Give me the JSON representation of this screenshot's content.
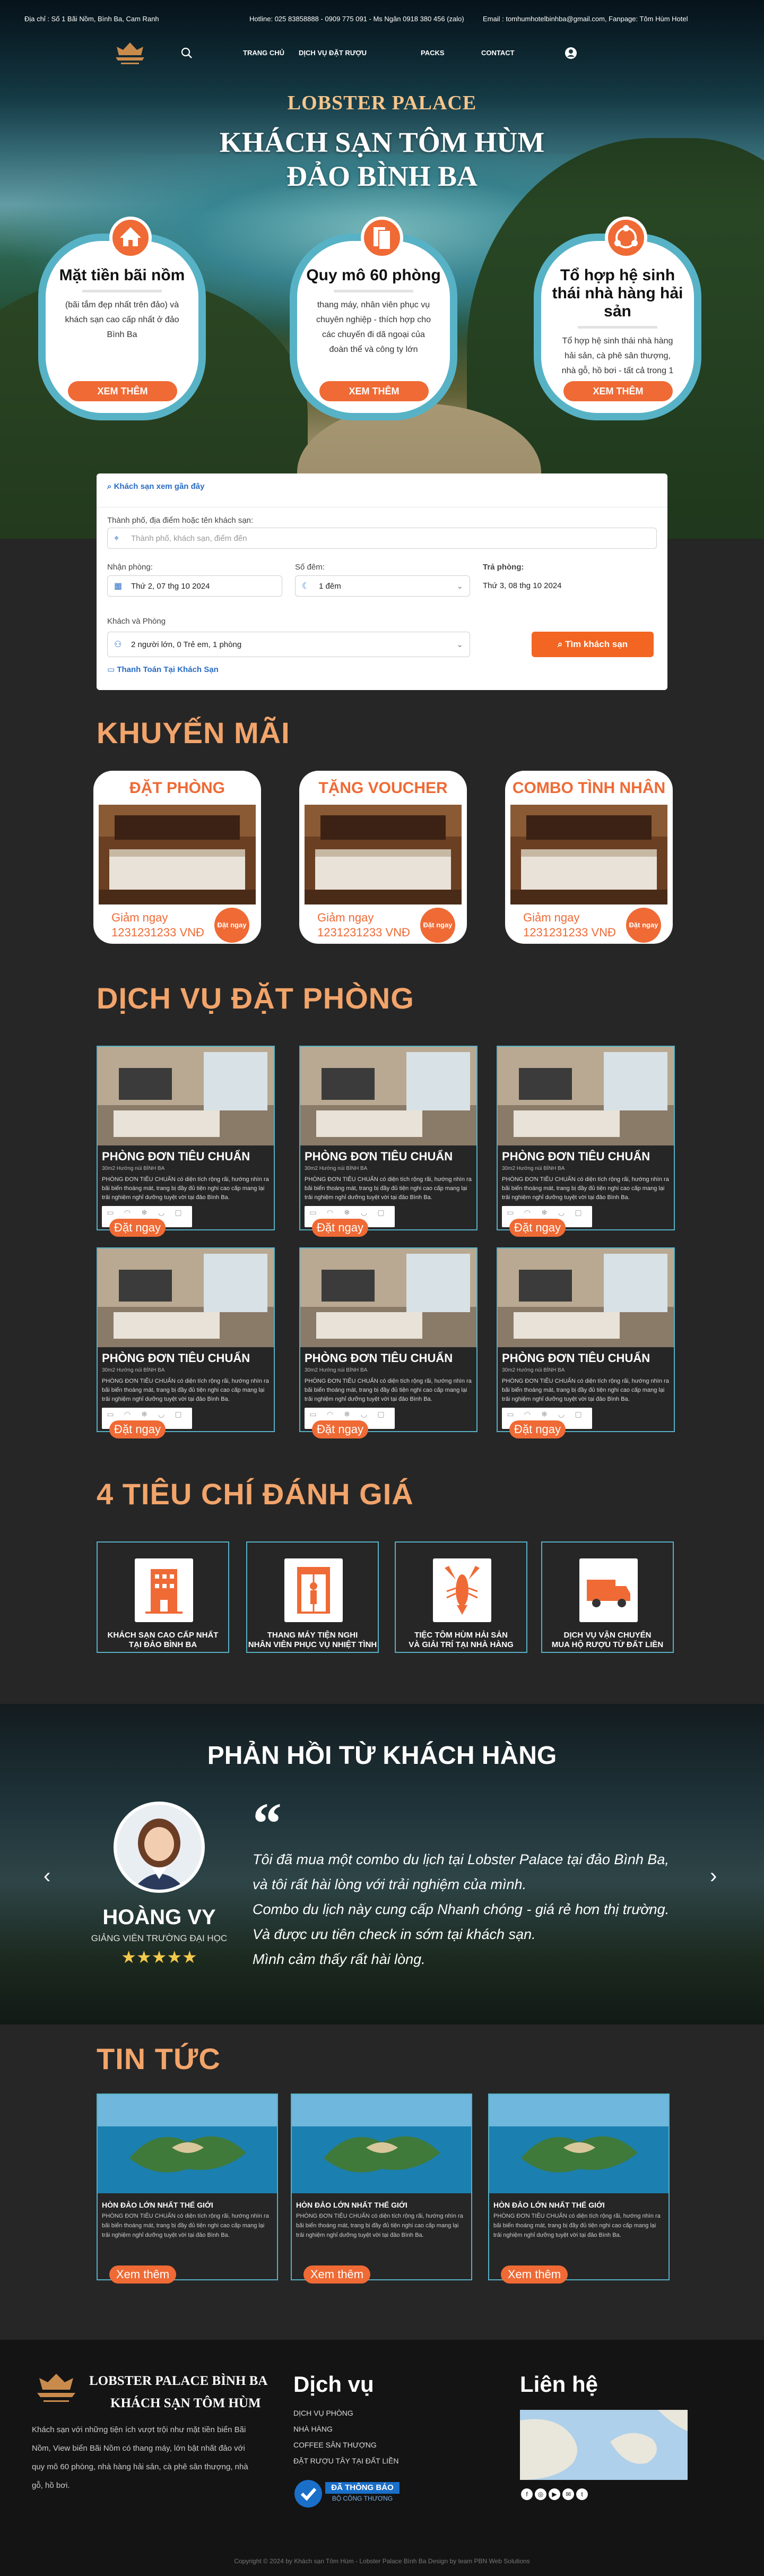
{
  "topbar": {
    "address": "Địa chỉ : Số 1 Bãi Nồm, Bình Ba, Cam Ranh",
    "hotline": "Hotline: 025 83858888 - 0909 775 091 - Ms Ngân 0918 380 456 (zalo)",
    "contact": "Email : tomhumhotelbinhba@gmail.com, Fanpage: Tôm Hùm Hotel"
  },
  "nav": {
    "items": [
      "TRANG CHỦ",
      "DỊCH VỤ ĐẶT RƯỢU",
      "PACKS",
      "CONTACT"
    ]
  },
  "hero": {
    "brand": "LOBSTER PALACE",
    "title_line1": "KHÁCH SẠN TÔM HÙM",
    "title_line2": "ĐẢO BÌNH BA"
  },
  "features": [
    {
      "title": "Mặt tiền bãi nồm",
      "desc": "(bãi tắm đẹp nhất trên đảo) và khách sạn cao cấp nhất ở đảo Bình Ba",
      "button": "XEM THÊM"
    },
    {
      "title": "Quy mô 60 phòng",
      "desc": "thang máy, nhân viên phục vụ chuyên nghiệp - thích hợp cho các chuyến đi dã ngoại của đoàn thể và công ty lớn",
      "button": "XEM THÊM"
    },
    {
      "title": "Tổ hợp hệ sinh thái nhà hàng hải sản",
      "desc": "Tổ hợp hệ sinh thái nhà hàng hải sản, cà phê sân thượng, nhà gỗ, hồ bơi - tất cả trong 1",
      "button": "XEM THÊM"
    }
  ],
  "booking": {
    "recent": "Khách sạn xem gần đây",
    "city_label": "Thành phố, địa điểm hoặc tên khách sạn:",
    "city_placeholder": "Thành phố, khách sạn, điểm đến",
    "checkin_label": "Nhận phòng:",
    "checkin_value": "Thứ 2, 07 thg 10 2024",
    "nights_label": "Số đêm:",
    "nights_value": "1 đêm",
    "checkout_label": "Trả phòng:",
    "checkout_value": "Thứ 3, 08 thg 10 2024",
    "guests_label": "Khách và Phòng",
    "guests_value": "2 người lớn, 0 Trẻ em, 1 phòng",
    "search_button": "Tìm khách sạn",
    "pay_link": "Thanh Toán Tại Khách Sạn"
  },
  "promotions": {
    "title": "KHUYẾN MÃI",
    "items": [
      {
        "title": "ĐẶT PHÒNG",
        "label": "Giảm ngay",
        "value": "1231231233 VNĐ",
        "badge": "Đặt ngay"
      },
      {
        "title": "TẶNG VOUCHER",
        "label": "Giảm ngay",
        "value": "1231231233 VNĐ",
        "badge": "Đặt ngay"
      },
      {
        "title": "COMBO TÌNH NHÂN",
        "label": "Giảm ngay",
        "value": "1231231233 VNĐ",
        "badge": "Đặt ngay"
      }
    ]
  },
  "rooms": {
    "title": "DỊCH VỤ ĐẶT PHÒNG",
    "items": [
      {
        "name": "PHÒNG ĐƠN TIÊU CHUẨN",
        "meta": "30m2     Hướng núi BÌNH BA",
        "desc": "PHÒNG ĐƠN TIÊU CHUẨN có diện tích rộng rãi, hướng nhìn ra bãi biển thoáng mát, trang bị đầy đủ tiện nghi cao cấp mang lại trải nghiệm nghỉ dưỡng tuyệt vời tại đảo Bình Ba.",
        "button": "Đặt ngay"
      },
      {
        "name": "PHÒNG ĐƠN TIÊU CHUẨN",
        "meta": "30m2     Hướng núi BÌNH BA",
        "desc": "PHÒNG ĐƠN TIÊU CHUẨN có diện tích rộng rãi, hướng nhìn ra bãi biển thoáng mát, trang bị đầy đủ tiện nghi cao cấp mang lại trải nghiệm nghỉ dưỡng tuyệt vời tại đảo Bình Ba.",
        "button": "Đặt ngay"
      },
      {
        "name": "PHÒNG ĐƠN TIÊU CHUẨN",
        "meta": "30m2     Hướng núi BÌNH BA",
        "desc": "PHÒNG ĐƠN TIÊU CHUẨN có diện tích rộng rãi, hướng nhìn ra bãi biển thoáng mát, trang bị đầy đủ tiện nghi cao cấp mang lại trải nghiệm nghỉ dưỡng tuyệt vời tại đảo Bình Ba.",
        "button": "Đặt ngay"
      },
      {
        "name": "PHÒNG ĐƠN TIÊU CHUẨN",
        "meta": "30m2     Hướng núi BÌNH BA",
        "desc": "PHÒNG ĐƠN TIÊU CHUẨN có diện tích rộng rãi, hướng nhìn ra bãi biển thoáng mát, trang bị đầy đủ tiện nghi cao cấp mang lại trải nghiệm nghỉ dưỡng tuyệt vời tại đảo Bình Ba.",
        "button": "Đặt ngay"
      },
      {
        "name": "PHÒNG ĐƠN TIÊU CHUẨN",
        "meta": "30m2     Hướng núi BÌNH BA",
        "desc": "PHÒNG ĐƠN TIÊU CHUẨN có diện tích rộng rãi, hướng nhìn ra bãi biển thoáng mát, trang bị đầy đủ tiện nghi cao cấp mang lại trải nghiệm nghỉ dưỡng tuyệt vời tại đảo Bình Ba.",
        "button": "Đặt ngay"
      },
      {
        "name": "PHÒNG ĐƠN TIÊU CHUẨN",
        "meta": "30m2     Hướng núi BÌNH BA",
        "desc": "PHÒNG ĐƠN TIÊU CHUẨN có diện tích rộng rãi, hướng nhìn ra bãi biển thoáng mát, trang bị đầy đủ tiện nghi cao cấp mang lại trải nghiệm nghỉ dưỡng tuyệt vời tại đảo Bình Ba.",
        "button": "Đặt ngay"
      }
    ]
  },
  "criteria": {
    "title": "4 TIÊU CHÍ ĐÁNH GIÁ",
    "items": [
      {
        "line1": "KHÁCH SẠN CAO CẤP NHẤT",
        "line2": "TẠI ĐẢO BÌNH BA",
        "icon": "hotel-building-icon"
      },
      {
        "line1": "THANG MÁY TIỆN NGHI",
        "line2": "NHÂN VIÊN PHỤC VỤ NHIỆT TÌNH",
        "icon": "elevator-icon"
      },
      {
        "line1": "TIỆC TÔM HÙM HẢI SẢN",
        "line2": "VÀ GIẢI TRÍ TẠI NHÀ HÀNG",
        "icon": "lobster-icon"
      },
      {
        "line1": "DỊCH VỤ VẬN CHUYỂN",
        "line2": "MUA HỘ RƯỢU TỪ ĐẤT LIỀN",
        "icon": "delivery-truck-icon"
      }
    ]
  },
  "testimonial": {
    "title": "PHẢN HỒI TỪ KHÁCH HÀNG",
    "name": "HOÀNG VY",
    "role": "GIẢNG VIÊN TRƯỜNG ĐẠI HỌC",
    "stars": "★★★★★",
    "quote_mark": "“",
    "lines": [
      "Tôi đã mua một combo du lịch tại Lobster Palace tại đảo Bình Ba,",
      "và tôi rất hài lòng với trải nghiệm của mình.",
      "Combo du lịch này cung cấp Nhanh chóng - giá rẻ hơn thị trường.",
      "Và được ưu tiên check in sớm tại khách sạn.",
      "Mình cảm thấy rất hài lòng."
    ]
  },
  "news": {
    "title": "TIN TỨC",
    "items": [
      {
        "title": "HÒN ĐẢO LỚN NHẤT THẾ GIỚI",
        "desc": "PHÒNG ĐƠN TIÊU CHUẨN có diện tích rộng rãi, hướng nhìn ra bãi biển thoáng mát, trang bị đầy đủ tiện nghi cao cấp mang lại trải nghiệm nghỉ dưỡng tuyệt vời tại đảo Bình Ba.",
        "button": "Xem thêm"
      },
      {
        "title": "HÒN ĐẢO LỚN NHẤT THẾ GIỚI",
        "desc": "PHÒNG ĐƠN TIÊU CHUẨN có diện tích rộng rãi, hướng nhìn ra bãi biển thoáng mát, trang bị đầy đủ tiện nghi cao cấp mang lại trải nghiệm nghỉ dưỡng tuyệt vời tại đảo Bình Ba.",
        "button": "Xem thêm"
      },
      {
        "title": "HÒN ĐẢO LỚN NHẤT THẾ GIỚI",
        "desc": "PHÒNG ĐƠN TIÊU CHUẨN có diện tích rộng rãi, hướng nhìn ra bãi biển thoáng mát, trang bị đầy đủ tiện nghi cao cấp mang lại trải nghiệm nghỉ dưỡng tuyệt vời tại đảo Bình Ba.",
        "button": "Xem thêm"
      }
    ]
  },
  "footer": {
    "brand1": "LOBSTER PALACE  BÌNH BA",
    "brand2": "KHÁCH SẠN TÔM HÙM",
    "desc": "Khách sạn với những tiện ích vượt trội như mặt tiền biển Bãi Nồm, View biển Bãi Nồm có thang máy, lớn bật nhất đảo với quy mô 60 phòng, nhà hàng hải sản, cà phê sân thượng, nhà gỗ, hồ bơi.",
    "services_title": "Dịch vụ",
    "services": [
      "DỊCH VỤ PHÒNG",
      "NHÀ HÀNG",
      "COFFEE SÂN THƯỢNG",
      "ĐẶT  RƯỢU TÂY TẠI ĐẤT LIỀN"
    ],
    "badge_line1": "ĐÃ THÔNG BÁO",
    "badge_line2": "BỘ CÔNG THƯƠNG",
    "contact_title": "Liên hệ",
    "copyright": "Copyright © 2024  by Khách sạn Tôm Hùm - Lobster Palace Bình Ba        Design by team PBN Web Solutions"
  },
  "colors": {
    "accent": "#ef6a35",
    "title": "#f2a46a",
    "border": "#56b0c4",
    "background": "#262626"
  }
}
